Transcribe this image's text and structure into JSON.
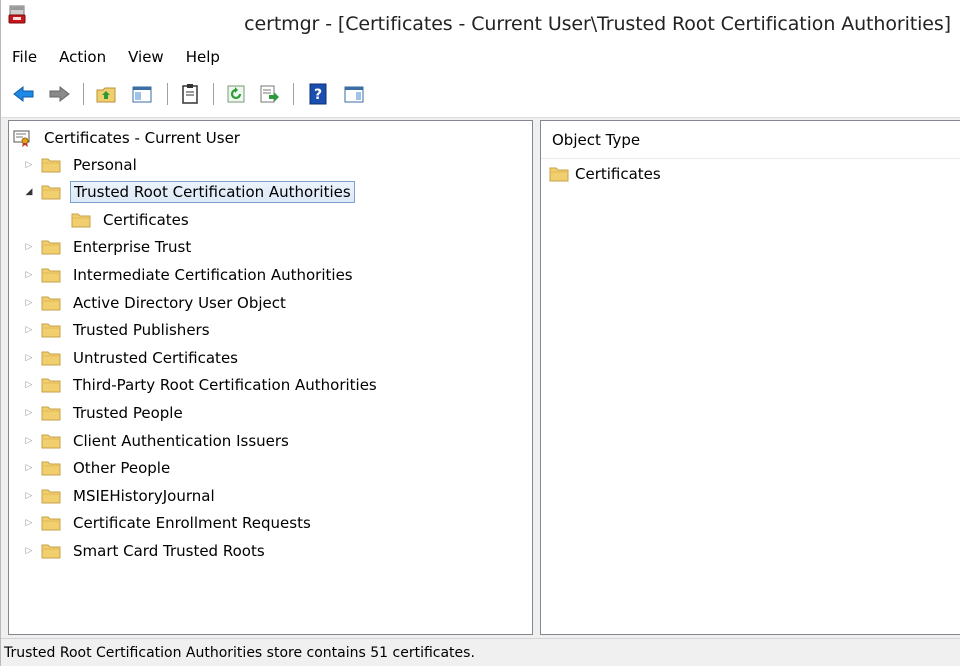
{
  "window": {
    "title": "certmgr - [Certificates - Current User\\Trusted Root Certification Authorities]"
  },
  "menu": [
    "File",
    "Action",
    "View",
    "Help"
  ],
  "toolbar": {
    "buttons": [
      "back-icon",
      "forward-icon",
      "up-folder-icon",
      "show-hide-tree-icon",
      "clipboard-icon",
      "refresh-icon",
      "export-list-icon",
      "help-icon",
      "show-action-pane-icon"
    ]
  },
  "tree": {
    "root": "Certificates - Current User",
    "items": [
      {
        "label": "Personal",
        "expanded": false
      },
      {
        "label": "Trusted Root Certification Authorities",
        "expanded": true,
        "selected": true,
        "children": [
          {
            "label": "Certificates"
          }
        ]
      },
      {
        "label": "Enterprise Trust",
        "expanded": false
      },
      {
        "label": "Intermediate Certification Authorities",
        "expanded": false
      },
      {
        "label": "Active Directory User Object",
        "expanded": false
      },
      {
        "label": "Trusted Publishers",
        "expanded": false
      },
      {
        "label": "Untrusted Certificates",
        "expanded": false
      },
      {
        "label": "Third-Party Root Certification Authorities",
        "expanded": false
      },
      {
        "label": "Trusted People",
        "expanded": false
      },
      {
        "label": "Client Authentication Issuers",
        "expanded": false
      },
      {
        "label": "Other People",
        "expanded": false
      },
      {
        "label": "MSIEHistoryJournal",
        "expanded": false
      },
      {
        "label": "Certificate Enrollment Requests",
        "expanded": false
      },
      {
        "label": "Smart Card Trusted Roots",
        "expanded": false
      }
    ]
  },
  "details": {
    "column_header": "Object Type",
    "items": [
      "Certificates"
    ]
  },
  "status": {
    "text": "Trusted Root Certification Authorities store contains 51 certificates."
  },
  "colors": {
    "folder": "#f1cf6f",
    "selection_border": "#7da2ce",
    "pane_border": "#828790"
  }
}
